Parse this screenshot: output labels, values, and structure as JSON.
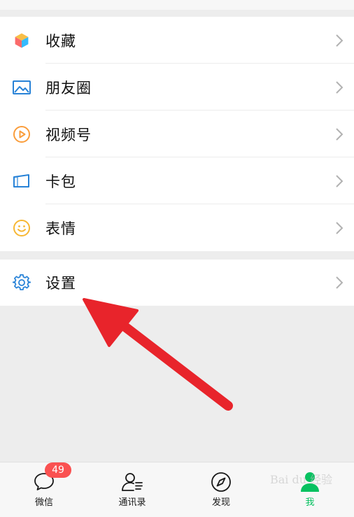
{
  "menu_top": [
    {
      "key": "favorites",
      "label": "收藏",
      "icon": "cube-icon"
    },
    {
      "key": "moments",
      "label": "朋友圈",
      "icon": "image-icon"
    },
    {
      "key": "channels",
      "label": "视频号",
      "icon": "play-circle-icon"
    },
    {
      "key": "cards",
      "label": "卡包",
      "icon": "card-icon"
    },
    {
      "key": "stickers",
      "label": "表情",
      "icon": "smile-icon"
    }
  ],
  "menu_settings": {
    "label": "设置",
    "icon": "gear-icon"
  },
  "tabbar": {
    "chats": {
      "label": "微信",
      "badge": "49"
    },
    "contacts": {
      "label": "通讯录"
    },
    "discover": {
      "label": "发现"
    },
    "me": {
      "label": "我"
    }
  },
  "colors": {
    "accent": "#07c160",
    "badge": "#fa5151",
    "arrow": "#e8242b",
    "background": "#ededed"
  }
}
